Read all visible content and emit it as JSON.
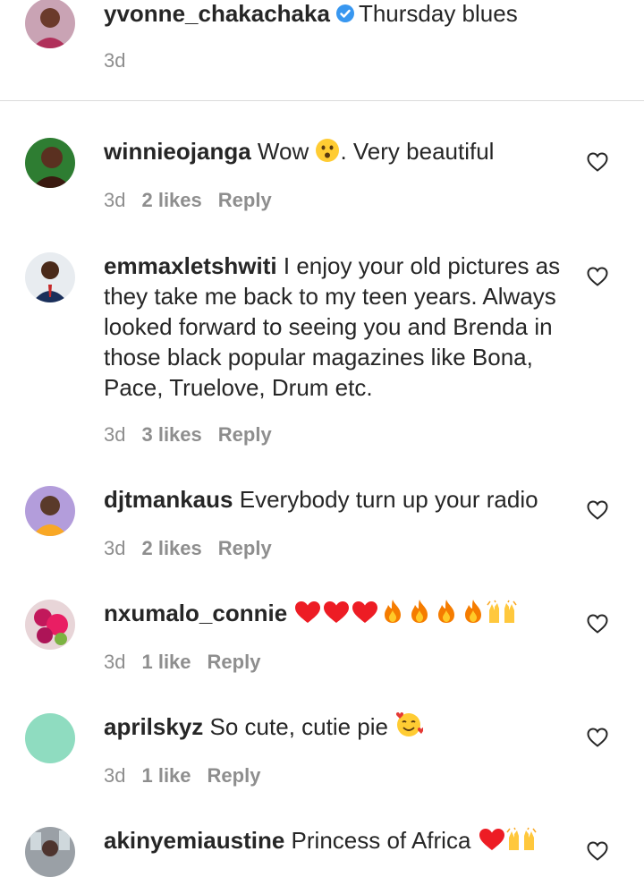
{
  "caption": {
    "username": "yvonne_chakachaka",
    "verified": true,
    "text": "Thursday blues",
    "time": "3d"
  },
  "comments": [
    {
      "username": "winnieojanga",
      "text_before": "Wow ",
      "emoji": "hushed-face",
      "text_after": ". Very beautiful",
      "time": "3d",
      "likes": "2 likes",
      "reply": "Reply",
      "avatar_color": "#2e7d32"
    },
    {
      "username": "emmaxletshwiti",
      "text": "I enjoy your old pictures as they take me back to my teen years. Always looked forward to seeing you and Brenda in those black popular magazines like Bona, Pace, Truelove, Drum etc.",
      "time": "3d",
      "likes": "3 likes",
      "reply": "Reply",
      "avatar_color": "#1a2f5a"
    },
    {
      "username": "djtmankaus",
      "text": "Everybody turn up your radio",
      "time": "3d",
      "likes": "2 likes",
      "reply": "Reply",
      "avatar_color": "#8e6fb5"
    },
    {
      "username": "nxumalo_connie",
      "emojis": [
        "red-heart",
        "red-heart",
        "red-heart",
        "fire",
        "fire",
        "fire",
        "fire",
        "raising-hands"
      ],
      "time": "3d",
      "likes": "1 like",
      "reply": "Reply",
      "avatar_color": "#b8627a"
    },
    {
      "username": "aprilskyz",
      "text": "So cute, cutie pie ",
      "emoji": "smiling-face-with-hearts",
      "time": "3d",
      "likes": "1 like",
      "reply": "Reply",
      "avatar_color": "#8fdcc0"
    },
    {
      "username": "akinyemiaustine",
      "text": "Princess of Africa ",
      "emojis": [
        "red-heart",
        "raising-hands"
      ],
      "avatar_color": "#9aa0a6"
    }
  ],
  "colors": {
    "text": "#262626",
    "meta": "#8e8e8e",
    "divider": "#dbdbdb",
    "verified_blue": "#3897f0",
    "heart_red": "#ed1c24",
    "fire_orange": "#f57c00"
  }
}
